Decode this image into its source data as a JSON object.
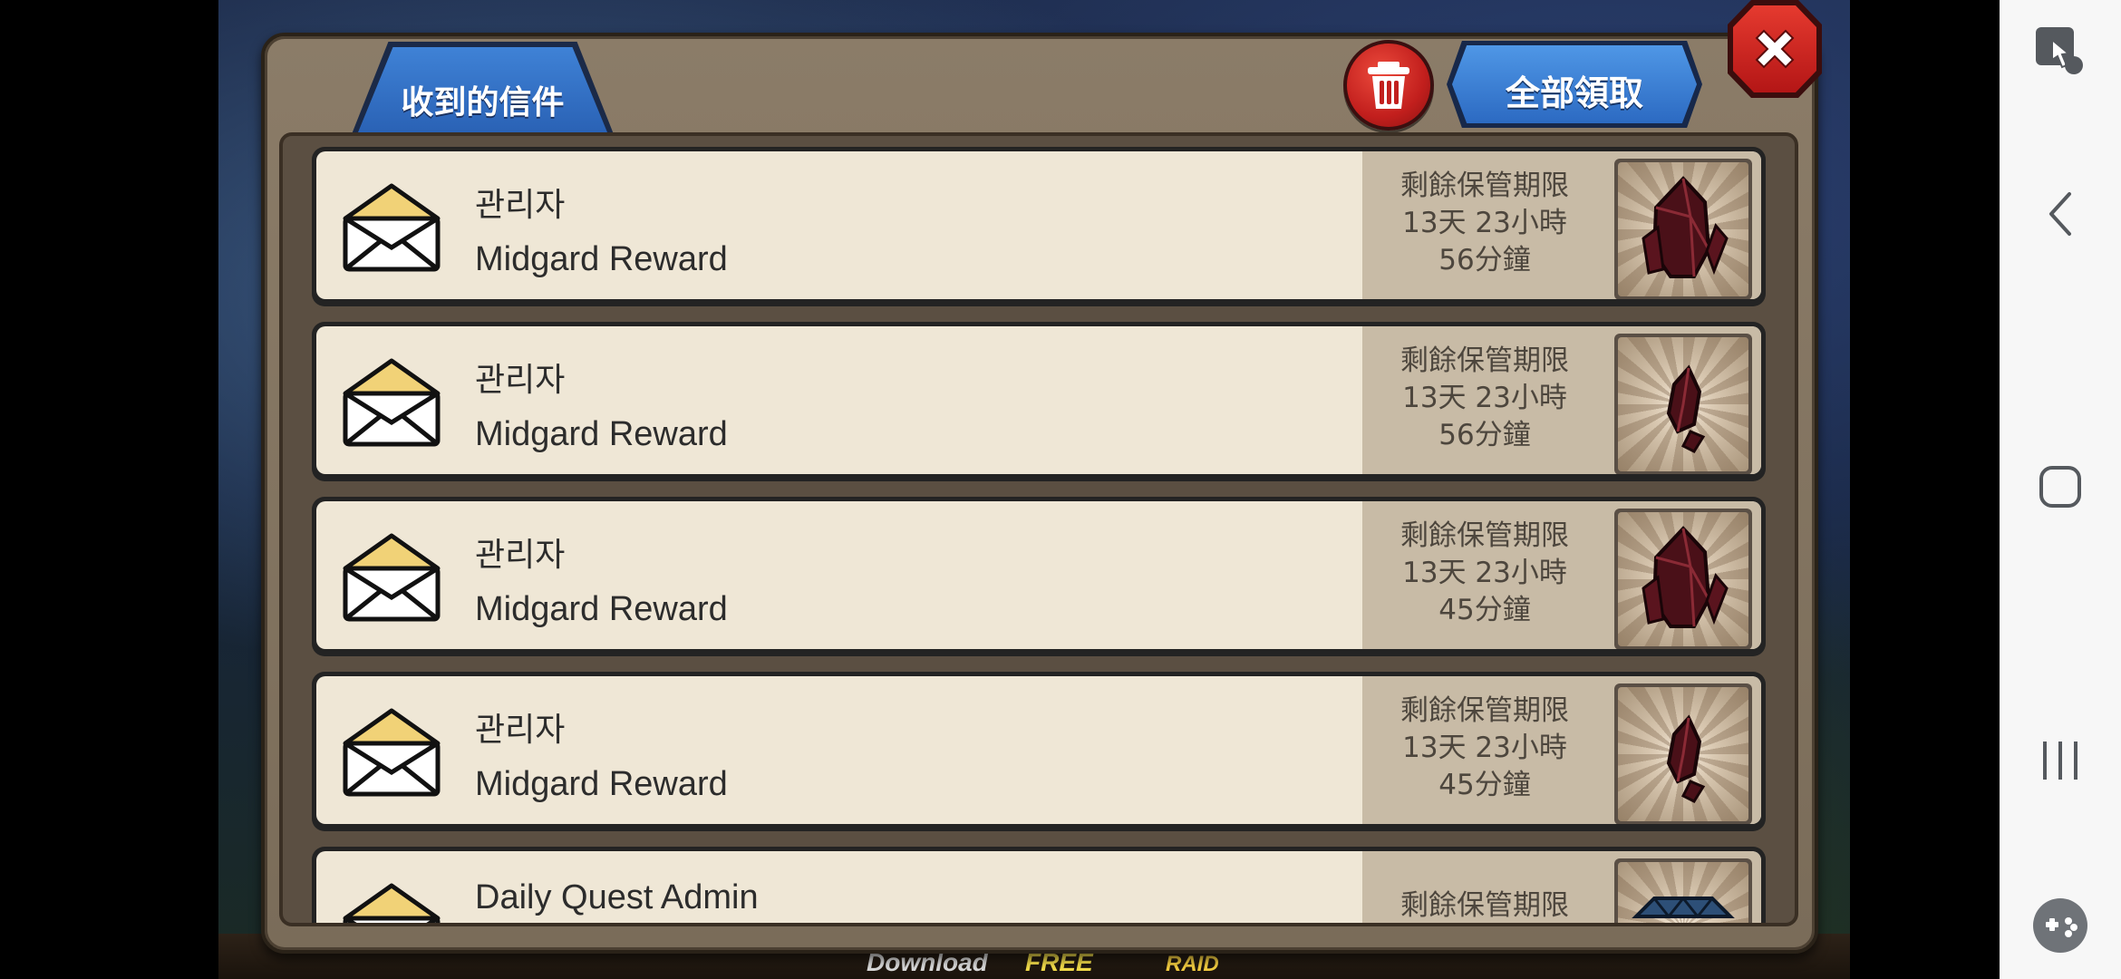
{
  "mailbox": {
    "tab_title": "收到的信件",
    "claim_all_label": "全部領取",
    "items": [
      {
        "sender": "관리자",
        "subject": "Midgard Reward",
        "expiry_label": "剩餘保管期限",
        "expiry_days": "13天 23小時",
        "expiry_minutes": "56分鐘",
        "reward_icon": "large-red-crystal-icon"
      },
      {
        "sender": "관리자",
        "subject": "Midgard Reward",
        "expiry_label": "剩餘保管期限",
        "expiry_days": "13天 23小時",
        "expiry_minutes": "56分鐘",
        "reward_icon": "small-red-shard-icon"
      },
      {
        "sender": "관리자",
        "subject": "Midgard Reward",
        "expiry_label": "剩餘保管期限",
        "expiry_days": "13天 23小時",
        "expiry_minutes": "45分鐘",
        "reward_icon": "large-red-crystal-icon"
      },
      {
        "sender": "관리자",
        "subject": "Midgard Reward",
        "expiry_label": "剩餘保管期限",
        "expiry_days": "13天 23小時",
        "expiry_minutes": "45分鐘",
        "reward_icon": "small-red-shard-icon"
      },
      {
        "sender": "Daily Quest Admin",
        "subject": "",
        "expiry_label": "剩餘保管期限",
        "expiry_days": "",
        "expiry_minutes": "",
        "reward_icon": "blue-item-icon"
      }
    ]
  },
  "background": {
    "download_text": "Download",
    "free_text": "FREE",
    "raid_text": "RAID"
  },
  "navbar": {
    "icons": [
      "accessibility-touch-icon",
      "back-icon",
      "home-icon",
      "recents-icon",
      "game-tools-icon"
    ]
  },
  "colors": {
    "panel": "#8b7c68",
    "tab_blue": "#3f82d6",
    "close_red": "#d12a22",
    "row_bg": "#efe7d6",
    "row_right_bg": "#c8bba6"
  }
}
